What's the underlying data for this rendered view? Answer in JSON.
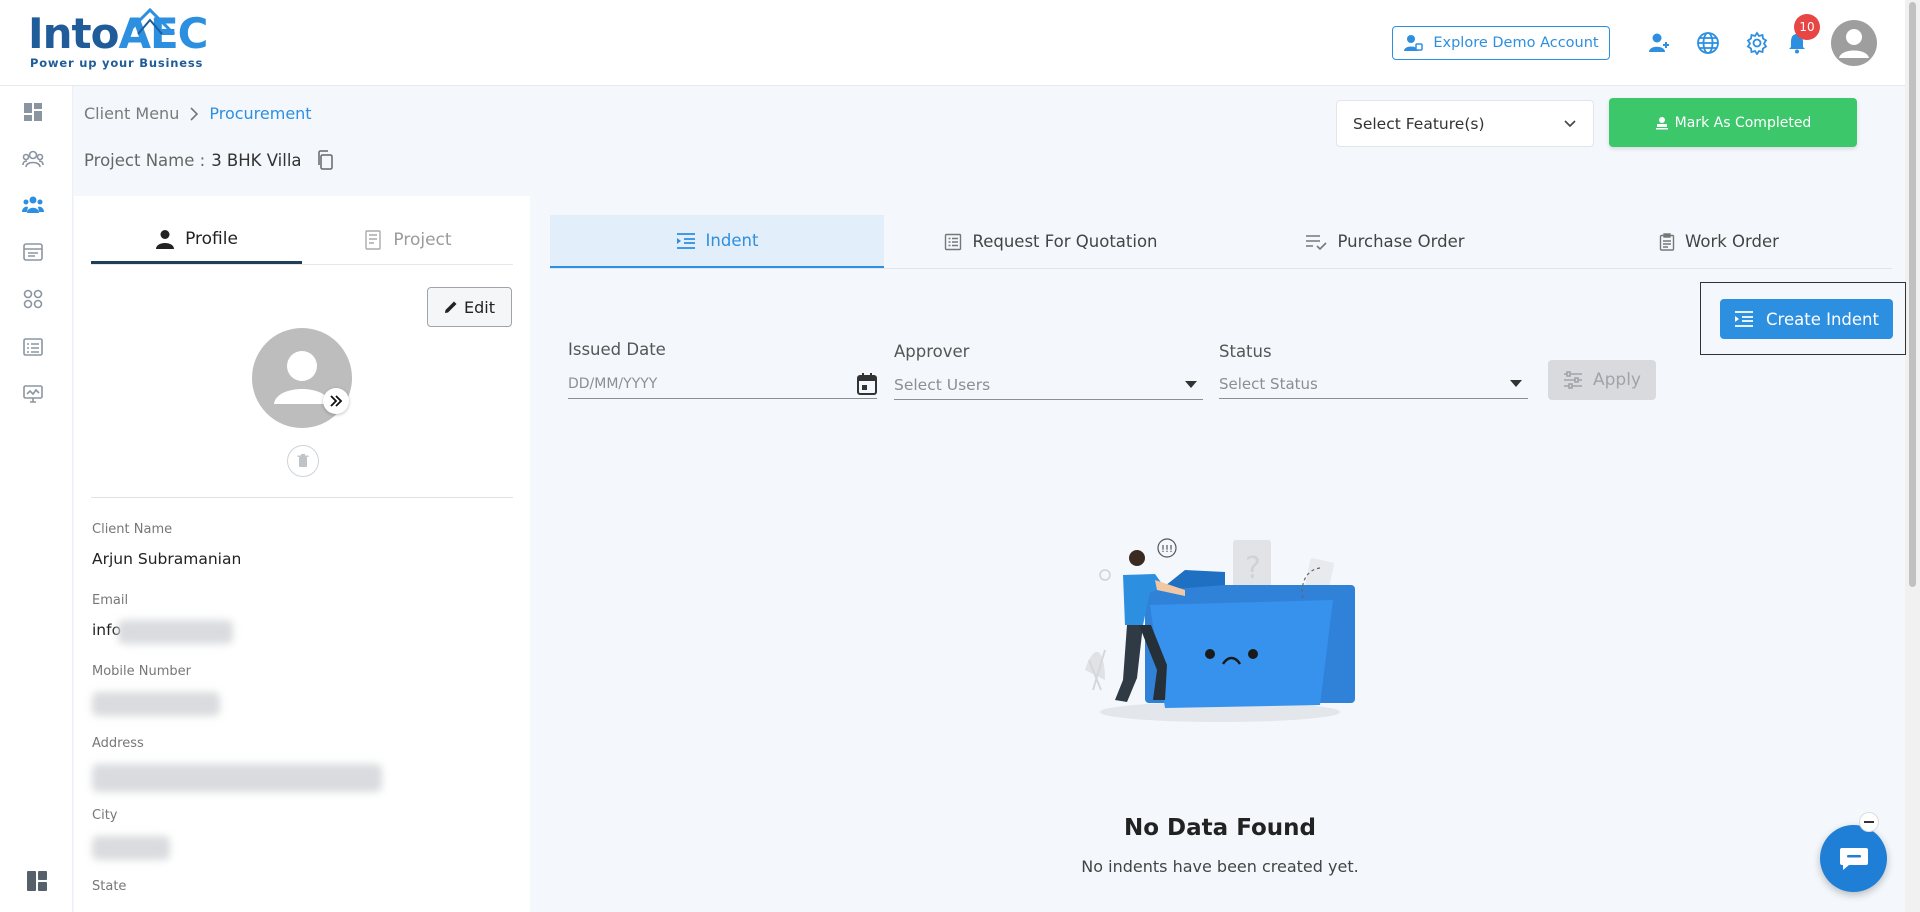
{
  "brand": {
    "name_left": "Into",
    "name_right": "AEC",
    "tagline": "Power up your Business"
  },
  "header": {
    "demo_button": "Explore Demo Account",
    "notification_count": "10",
    "icons": [
      "add-user-icon",
      "globe-icon",
      "gear-icon",
      "bell-icon",
      "avatar"
    ]
  },
  "rail": {
    "items": [
      "dashboard-icon",
      "team-icon",
      "clients-icon",
      "billing-icon",
      "modules-icon",
      "list-icon",
      "monitor-icon"
    ],
    "bottom": "layout-icon"
  },
  "breadcrumb": {
    "root": "Client Menu",
    "current": "Procurement"
  },
  "project": {
    "label": "Project Name :",
    "value": "3 BHK Villa"
  },
  "feature_select": {
    "value": "Select Feature(s)"
  },
  "mark_completed": "Mark As Completed",
  "profile_panel": {
    "tabs": [
      {
        "label": "Profile",
        "active": true
      },
      {
        "label": "Project",
        "active": false
      }
    ],
    "edit_label": "Edit",
    "fields": {
      "client_name_label": "Client Name",
      "client_name_value": "Arjun Subramanian",
      "email_label": "Email",
      "email_value": "info",
      "mobile_label": "Mobile Number",
      "address_label": "Address",
      "city_label": "City",
      "state_label": "State"
    }
  },
  "main": {
    "tabs": [
      {
        "label": "Indent",
        "active": true
      },
      {
        "label": "Request For Quotation",
        "active": false
      },
      {
        "label": "Purchase Order",
        "active": false
      },
      {
        "label": "Work Order",
        "active": false
      }
    ],
    "create_button": "Create Indent",
    "filters": {
      "issued_date_label": "Issued Date",
      "issued_date_placeholder": "DD/MM/YYYY",
      "approver_label": "Approver",
      "approver_placeholder": "Select Users",
      "status_label": "Status",
      "status_placeholder": "Select Status",
      "apply_label": "Apply"
    },
    "empty_state": {
      "title": "No Data Found",
      "subtitle": "No indents have been created yet."
    }
  },
  "colors": {
    "primary": "#2d8fe0",
    "success": "#3cc76a",
    "badge": "#e84545",
    "brand_navy": "#1f5c99"
  }
}
